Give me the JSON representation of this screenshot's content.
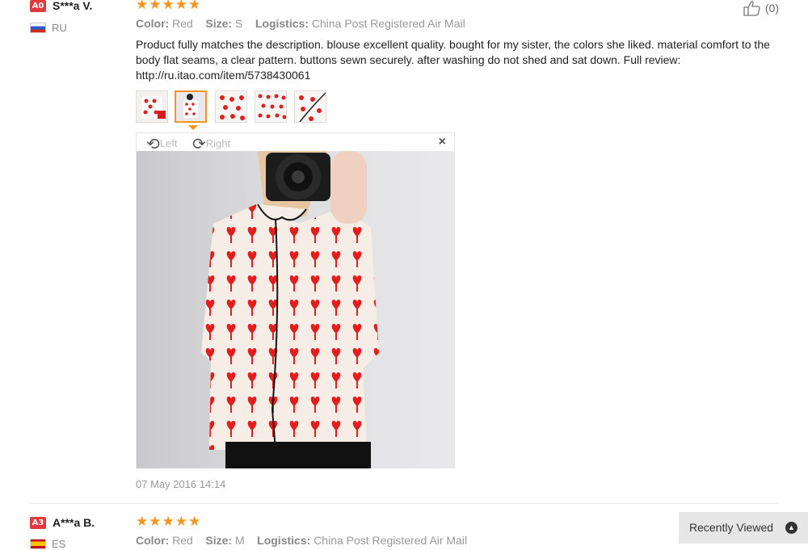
{
  "review1": {
    "level": "A0",
    "username": "S***a V.",
    "country": "RU",
    "rating": 5,
    "stars": "★★★★★",
    "color_label": "Color:",
    "color_value": "Red",
    "size_label": "Size:",
    "size_value": "S",
    "logistics_label": "Logistics:",
    "logistics_value": "China Post Registered Air Mail",
    "text": "Product fully matches the description. blouse excellent quality. bought for my sister, the colors she liked. material comfort to the body flat seams, a clear pattern. buttons sewn securely. after washing do not shed and sat down. Full review: http://ru.itao.com/item/5738430061",
    "likes": "(0)",
    "thumbnails": [
      "thumb-1",
      "thumb-2",
      "thumb-3",
      "thumb-4",
      "thumb-5"
    ],
    "viewer": {
      "rotate_left_label": "Left",
      "rotate_right_label": "Right",
      "close_label": "×"
    },
    "date": "07 May 2016 14:14"
  },
  "review2": {
    "level": "A3",
    "username": "A***a B.",
    "country": "ES",
    "rating": 5,
    "stars": "★★★★★",
    "color_label": "Color:",
    "color_value": "Red",
    "size_label": "Size:",
    "size_value": "M",
    "logistics_label": "Logistics:",
    "logistics_value": "China Post Registered Air Mail"
  },
  "recently_viewed": {
    "label": "Recently Viewed"
  },
  "colors": {
    "accent": "#f7931e",
    "badge": "#e4393c",
    "heart": "#e02020"
  }
}
